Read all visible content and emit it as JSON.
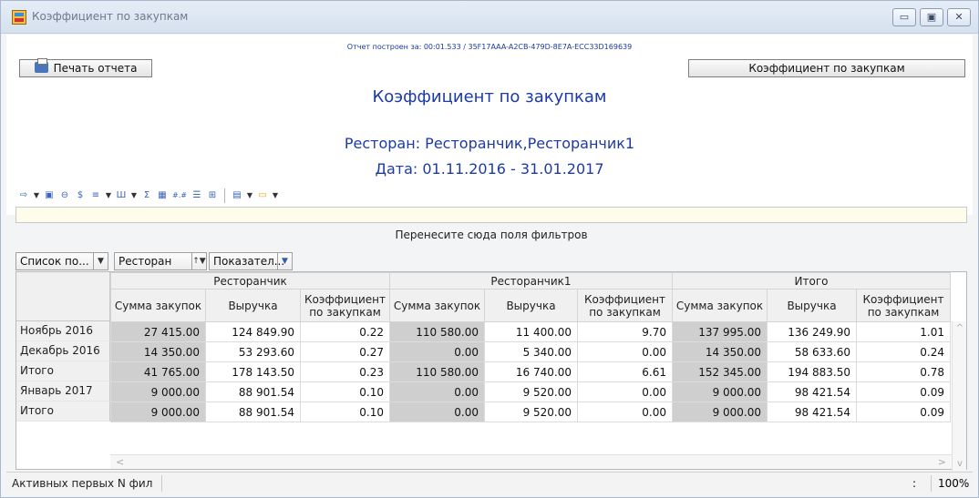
{
  "window": {
    "title": "Коэффициент по закупкам",
    "buttons": {
      "minimize": "▭",
      "maximize": "▣",
      "close": "✕"
    }
  },
  "report": {
    "build_info": "Отчет построен за: 00:01.533 / 35F17AAA-A2CB-479D-8E7A-ECC33D169639",
    "print_button": "Печать отчета",
    "report_name_button": "Коэффициент по закупкам",
    "title": "Коэффициент по закупкам",
    "restaurant_line": "Ресторан: Ресторанчик,Ресторанчик1",
    "date_line": "Дата: 01.11.2016 - 31.01.2017"
  },
  "toolbar": {
    "icons": [
      "export-icon",
      "layout-icon",
      "hide-icon",
      "currency-icon",
      "column-icon",
      "bar-icon",
      "sum-icon",
      "format-icon",
      "decimal-icon",
      "align-icon",
      "grid-icon",
      "save-icon",
      "folder-icon"
    ],
    "decimal_label": "#.#"
  },
  "pivot": {
    "filter_drop_text": "Перенесите сюда поля фильтров",
    "field_buttons": {
      "list": "Список по...",
      "restaurant": "Ресторан",
      "indicators": "Показател..."
    },
    "groups": [
      "Ресторанчик",
      "Ресторанчик1",
      "Итого"
    ],
    "sub_headers": [
      "Сумма закупок",
      "Выручка",
      "Коэффициент по закупкам"
    ],
    "rows": [
      {
        "label": "Ноябрь 2016",
        "cells": [
          "27 415.00",
          "124 849.90",
          "0.22",
          "110 580.00",
          "11 400.00",
          "9.70",
          "137 995.00",
          "136 249.90",
          "1.01"
        ]
      },
      {
        "label": "Декабрь 2016",
        "cells": [
          "14 350.00",
          "53 293.60",
          "0.27",
          "0.00",
          "5 340.00",
          "0.00",
          "14 350.00",
          "58 633.60",
          "0.24"
        ]
      },
      {
        "label": "Итого",
        "cells": [
          "41 765.00",
          "178 143.50",
          "0.23",
          "110 580.00",
          "16 740.00",
          "6.61",
          "152 345.00",
          "194 883.50",
          "0.78"
        ]
      },
      {
        "label": "Январь 2017",
        "cells": [
          "9 000.00",
          "88 901.54",
          "0.10",
          "0.00",
          "9 520.00",
          "0.00",
          "9 000.00",
          "98 421.54",
          "0.09"
        ]
      },
      {
        "label": "Итого",
        "cells": [
          "9 000.00",
          "88 901.54",
          "0.10",
          "0.00",
          "9 520.00",
          "0.00",
          "9 000.00",
          "98 421.54",
          "0.09"
        ]
      }
    ]
  },
  "status": {
    "text": "Активных первых N фил",
    "colon": ":",
    "zoom": "100%"
  }
}
